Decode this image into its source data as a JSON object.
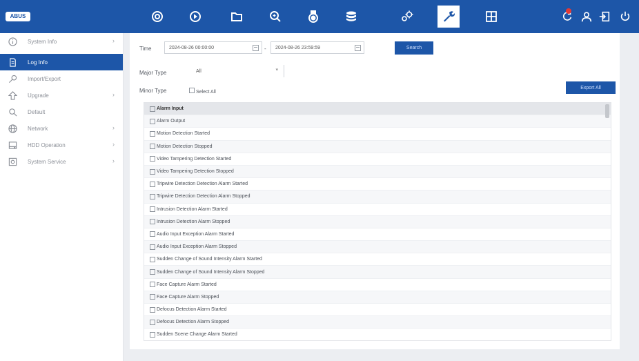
{
  "logo_text": "ABUS",
  "nav": [
    {
      "icon": "camera-lens-icon",
      "active": false
    },
    {
      "icon": "playback-icon",
      "active": false
    },
    {
      "icon": "folder-icon",
      "active": false
    },
    {
      "icon": "search-zoom-icon",
      "active": false
    },
    {
      "icon": "ptz-dome-icon",
      "active": false
    },
    {
      "icon": "database-icon",
      "active": false
    },
    {
      "icon": "config-gears-icon",
      "active": false
    },
    {
      "icon": "maintenance-wrench-icon",
      "active": true
    },
    {
      "icon": "grid-layout-icon",
      "active": false
    }
  ],
  "right_icons": [
    "refresh-icon",
    "user-alert-icon",
    "logout-icon",
    "power-icon"
  ],
  "sidebar": {
    "items": [
      {
        "label": "System Info",
        "icon": "info-icon",
        "active": false,
        "has_arrow": true
      },
      {
        "label": "Log Info",
        "icon": "document-icon",
        "active": true,
        "has_arrow": false
      },
      {
        "label": "Import/Export",
        "icon": "import-export-icon",
        "active": false,
        "has_arrow": false
      },
      {
        "label": "Upgrade",
        "icon": "upgrade-icon",
        "active": false,
        "has_arrow": true
      },
      {
        "label": "Default",
        "icon": "default-icon",
        "active": false,
        "has_arrow": false
      },
      {
        "label": "Network",
        "icon": "network-icon",
        "active": false,
        "has_arrow": true
      },
      {
        "label": "HDD Operation",
        "icon": "hdd-icon",
        "active": false,
        "has_arrow": true
      },
      {
        "label": "System Service",
        "icon": "service-icon",
        "active": false,
        "has_arrow": true
      }
    ]
  },
  "form": {
    "time_label": "Time",
    "start_time": "2024-08-26 00:00:00",
    "separator": "-",
    "end_time": "2024-08-26 23:59:59",
    "search_button": "Search",
    "major_type_label": "Major Type",
    "major_type_value": "All",
    "minor_type_label": "Minor Type",
    "select_all_label": "Select All",
    "export_button": "Export All"
  },
  "minor_types": [
    "Alarm Input",
    "Alarm Output",
    "Motion Detection Started",
    "Motion Detection Stopped",
    "Video Tampering Detection Started",
    "Video Tampering Detection Stopped",
    "Tripwire Detection Detection Alarm Started",
    "Tripwire Detection Detection Alarm Stopped",
    "Intrusion Detection Alarm Started",
    "Intrusion Detection Alarm Stopped",
    "Audio Input Exception Alarm Started",
    "Audio Input Exception Alarm Stopped",
    "Sudden Change of Sound Intensity Alarm Started",
    "Sudden Change of Sound Intensity Alarm Stopped",
    "Face Capture Alarm Started",
    "Face Capture Alarm Stopped",
    "Defocus Detection Alarm Started",
    "Defocus Detection Alarm Stopped",
    "Sudden Scene Change Alarm Started"
  ],
  "colors": {
    "primary": "#1d56a8",
    "background": "#eceef2"
  }
}
